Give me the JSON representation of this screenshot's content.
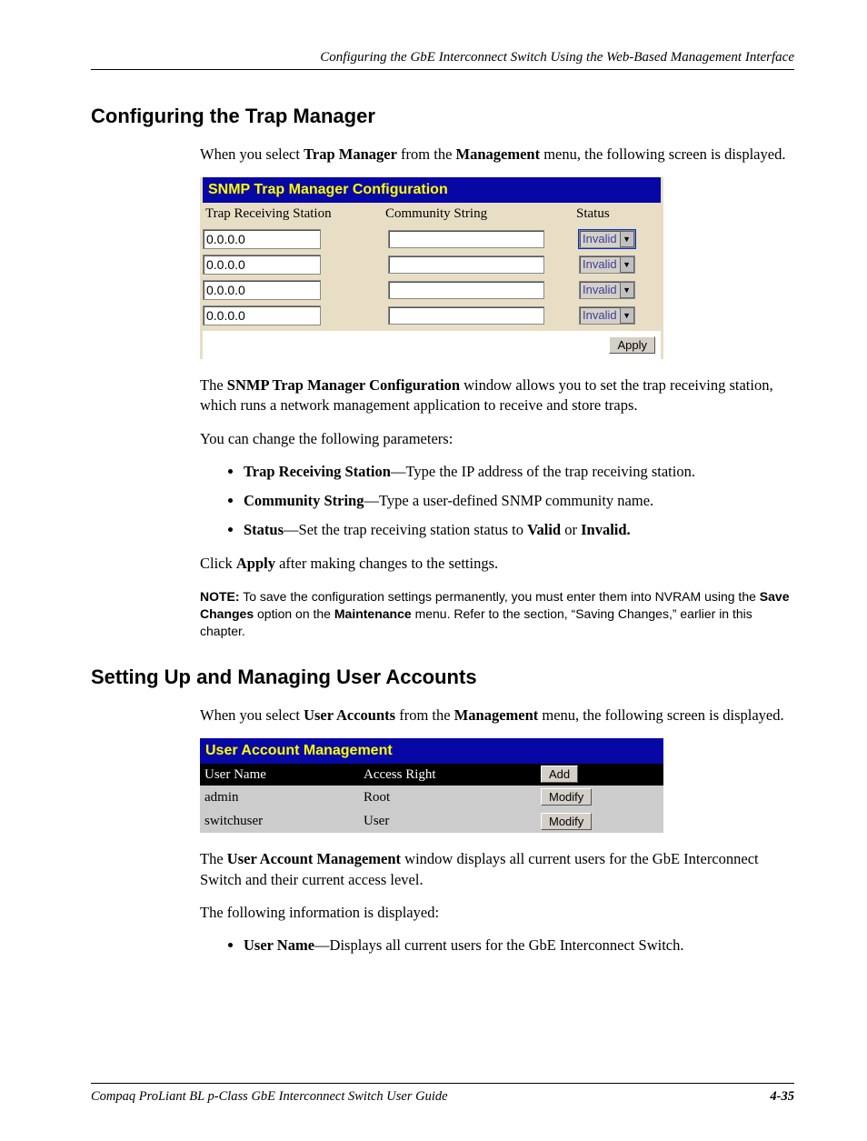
{
  "header": {
    "running": "Configuring the GbE Interconnect Switch Using the Web-Based Management Interface"
  },
  "section1": {
    "title": "Configuring the Trap Manager",
    "intro_a": "When you select ",
    "intro_b": "Trap Manager",
    "intro_c": " from the ",
    "intro_d": "Management",
    "intro_e": " menu, the following screen is displayed.",
    "panel": {
      "title": "SNMP Trap Manager Configuration",
      "col1": "Trap Receiving Station",
      "col2": "Community String",
      "col3": "Status",
      "rows": [
        {
          "ip": "0.0.0.0",
          "community": "",
          "status": "Invalid"
        },
        {
          "ip": "0.0.0.0",
          "community": "",
          "status": "Invalid"
        },
        {
          "ip": "0.0.0.0",
          "community": "",
          "status": "Invalid"
        },
        {
          "ip": "0.0.0.0",
          "community": "",
          "status": "Invalid"
        }
      ],
      "apply": "Apply"
    },
    "desc_a": "The ",
    "desc_b": "SNMP Trap Manager Configuration",
    "desc_c": " window allows you to set the trap receiving station, which runs a network management application to receive and store traps.",
    "params_intro": "You can change the following parameters:",
    "li1_b": "Trap Receiving Station",
    "li1_t": "—Type the IP address of the trap receiving station.",
    "li2_b": "Community String",
    "li2_t": "—Type a user-defined SNMP community name.",
    "li3_b": "Status",
    "li3_t1": "—Set the trap receiving station status to ",
    "li3_t2": "Valid",
    "li3_t3": " or ",
    "li3_t4": "Invalid.",
    "click_a": "Click ",
    "click_b": "Apply",
    "click_c": " after making changes to the settings.",
    "note_label": "NOTE:",
    "note_a": "  To save the configuration settings permanently, you must enter them into NVRAM using the ",
    "note_b": "Save Changes",
    "note_c": " option on the ",
    "note_d": "Maintenance",
    "note_e": " menu. Refer to the section, “Saving Changes,” earlier in this chapter."
  },
  "section2": {
    "title": "Setting Up and Managing User Accounts",
    "intro_a": "When you select ",
    "intro_b": "User Accounts",
    "intro_c": " from the ",
    "intro_d": "Management",
    "intro_e": " menu, the following screen is displayed.",
    "panel": {
      "title": "User Account Management",
      "col1": "User Name",
      "col2": "Access Right",
      "add": "Add",
      "rows": [
        {
          "name": "admin",
          "right": "Root",
          "btn": "Modify"
        },
        {
          "name": "switchuser",
          "right": "User",
          "btn": "Modify"
        }
      ]
    },
    "desc_a": "The ",
    "desc_b": "User Account Management",
    "desc_c": " window displays all current users for the GbE Interconnect Switch and their current access level.",
    "info_intro": "The following information is displayed:",
    "li1_b": "User Name",
    "li1_t": "—Displays all current users for the GbE Interconnect Switch."
  },
  "footer": {
    "left": "Compaq ProLiant BL p-Class GbE Interconnect Switch User Guide",
    "right": "4-35"
  }
}
